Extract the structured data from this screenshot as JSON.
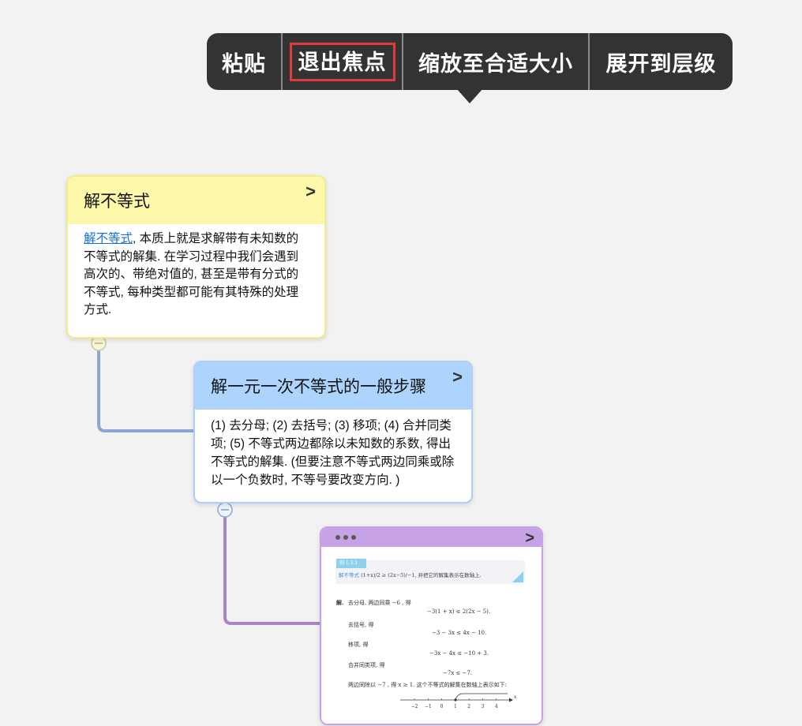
{
  "toolbar": {
    "paste": "粘贴",
    "exit_focus": "退出焦点",
    "zoom_fit": "缩放至合适大小",
    "expand_level": "展开到层级"
  },
  "colors": {
    "toolbar_bg": "#333333",
    "focus_outline": "#e33b3b",
    "node1_header": "#fdf8a9",
    "node2_header": "#add4fd",
    "node3_header": "#c8a2e6",
    "link1": "#8aa8d3",
    "link2": "#a985c9",
    "link_text": "#1a6fd6"
  },
  "icons": {
    "expand": "chevron-right-icon",
    "collapse": "minus-circle-icon",
    "more": "more-dots-icon"
  },
  "nodes": [
    {
      "title": "解不等式",
      "link_text": "解不等式",
      "body_rest": ", 本质上就是求解带有未知数的不等式的解集. 在学习过程中我们会遇到高次的、带绝对值的, 甚至是带有分式的不等式, 每种类型都可能有其特殊的处理方式."
    },
    {
      "title": "解一元一次不等式的一般步骤",
      "body": "(1) 去分母; (2) 去括号; (3) 移项; (4) 合并同类项; (5) 不等式两边都除以未知数的系数, 得出不等式的解集. (但要注意不等式两边同乘或除以一个负数时, 不等号要改变方向. )"
    },
    {
      "image": {
        "tag": "例 1.3.1",
        "prompt_link": "解不等式",
        "prompt_expr": "(1+x)/2 ≥ (2x−5)/−1",
        "prompt_rest": ", 并把它的解集表示在数轴上.",
        "solution_label": "解.",
        "step1": "去分母, 两边同乘 −6 , 得",
        "eq1": "−3(1 + x) ≤ 2(2x − 5).",
        "step2": "去括号, 得",
        "eq2": "−3 − 3x ≤ 4x − 10.",
        "step3": "移项, 得",
        "eq3": "−3x − 4x ≤ −10 + 3.",
        "step4": "合并同类项, 得",
        "eq4": "−7x ≤ −7.",
        "step5": "两边同除以 −7 , 得 x ≥ 1. 这个不等式的解集在数轴上表示如下:",
        "axis_ticks": [
          "−2",
          "−1",
          "0",
          "1",
          "2",
          "3",
          "4"
        ],
        "axis_var": "x"
      }
    }
  ]
}
